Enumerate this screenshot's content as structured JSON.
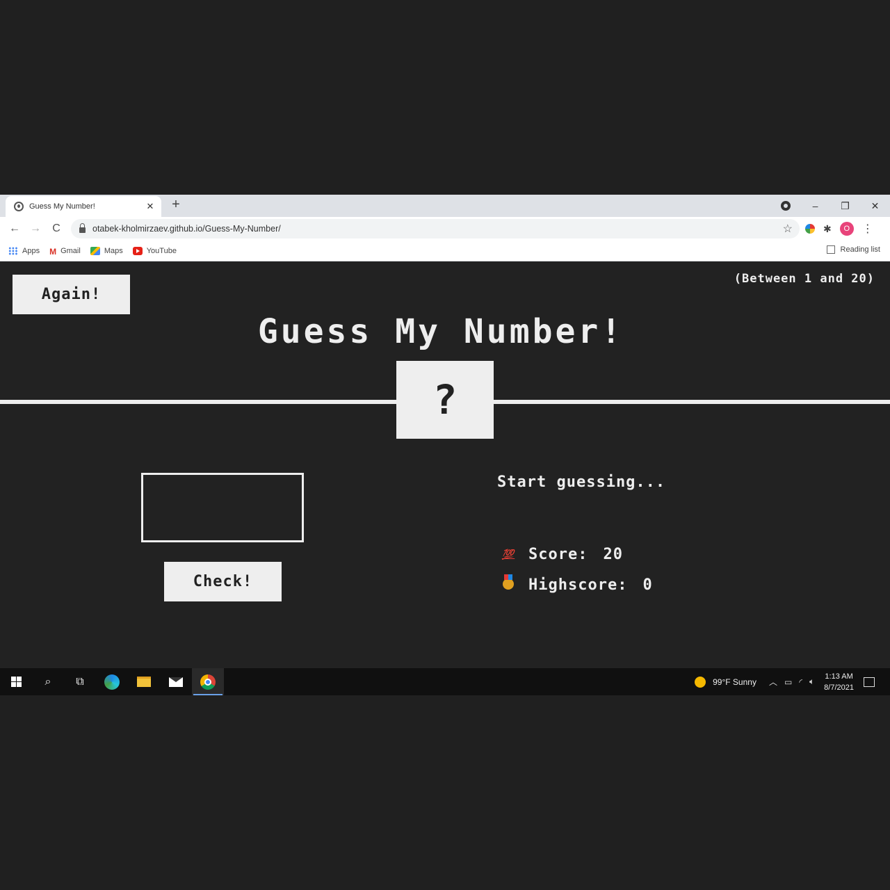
{
  "browser": {
    "tab_title": "Guess My Number!",
    "tab_close": "✕",
    "new_tab": "+",
    "url": "otabek-kholmirzaev.github.io/Guess-My-Number/",
    "window_controls": {
      "minimize": "–",
      "restore": "❐",
      "close": "✕"
    },
    "nav": {
      "back": "←",
      "forward": "→",
      "reload": "C"
    },
    "avatar_initial": "O",
    "bookmarks": [
      {
        "label": "Apps",
        "icon": "apps-grid-icon"
      },
      {
        "label": "Gmail",
        "icon": "gmail-icon"
      },
      {
        "label": "Maps",
        "icon": "maps-icon"
      },
      {
        "label": "YouTube",
        "icon": "youtube-icon"
      }
    ],
    "reading_list": "Reading list"
  },
  "game": {
    "again_label": "Again!",
    "range_hint": "(Between 1 and 20)",
    "title": "Guess My Number!",
    "secret_display": "?",
    "guess_value": "",
    "check_label": "Check!",
    "message": "Start guessing...",
    "score_label": "Score:",
    "score_value": "20",
    "highscore_label": "Highscore:",
    "highscore_value": "0",
    "score_icon": "💯",
    "highscore_icon": "medal-icon"
  },
  "taskbar": {
    "weather": "99°F  Sunny",
    "time": "1:13 AM",
    "date": "8/7/2021"
  },
  "colors": {
    "background": "#222222",
    "foreground": "#eeeeee"
  }
}
